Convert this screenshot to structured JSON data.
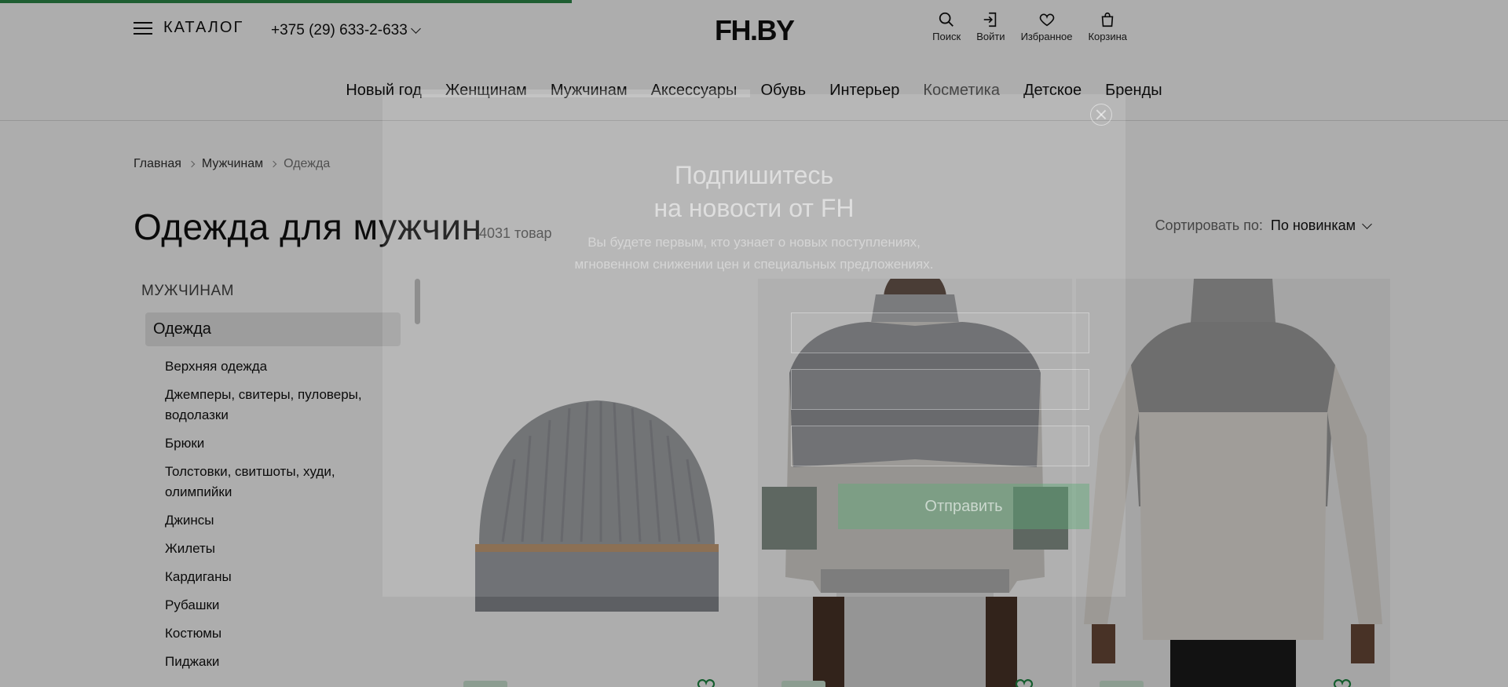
{
  "header": {
    "catalog_label": "КАТАЛОГ",
    "phone": "+375 (29) 633-2-633",
    "logo": "FH.BY",
    "actions": [
      {
        "label": "Поиск",
        "icon": "search-icon"
      },
      {
        "label": "Войти",
        "icon": "login-icon"
      },
      {
        "label": "Избранное",
        "icon": "heart-icon"
      },
      {
        "label": "Корзина",
        "icon": "bag-icon"
      }
    ]
  },
  "nav": {
    "items": [
      "Новый год",
      "Женщинам",
      "Мужчинам",
      "Аксессуары",
      "Обувь",
      "Интерьер",
      "Косметика",
      "Детское",
      "Бренды"
    ]
  },
  "breadcrumb": [
    "Главная",
    "Мужчинам",
    "Одежда"
  ],
  "page": {
    "title": "Одежда для мужчин",
    "count": "4031 товар",
    "sort_label": "Сортировать по:",
    "sort_value": "По новинкам"
  },
  "sidebar": {
    "heading": "МУЖЧИНАМ",
    "active": "Одежда",
    "items": [
      "Верхняя одежда",
      "Джемперы, свитеры, пуловеры, водолазки",
      "Брюки",
      "Толстовки, свитшоты, худи, олимпийки",
      "Джинсы",
      "Жилеты",
      "Кардиганы",
      "Рубашки",
      "Костюмы",
      "Пиджаки"
    ]
  },
  "modal": {
    "title_line1": "Подпишитесь",
    "title_line2": "на новости от FH",
    "description": "Вы будете первым, кто узнает о новых поступлениях, мгновенном снижении цен и специальных предложениях.",
    "submit_label": "Отправить"
  },
  "colors": {
    "accent": "#2e8b4a",
    "overlay": "#000000"
  }
}
